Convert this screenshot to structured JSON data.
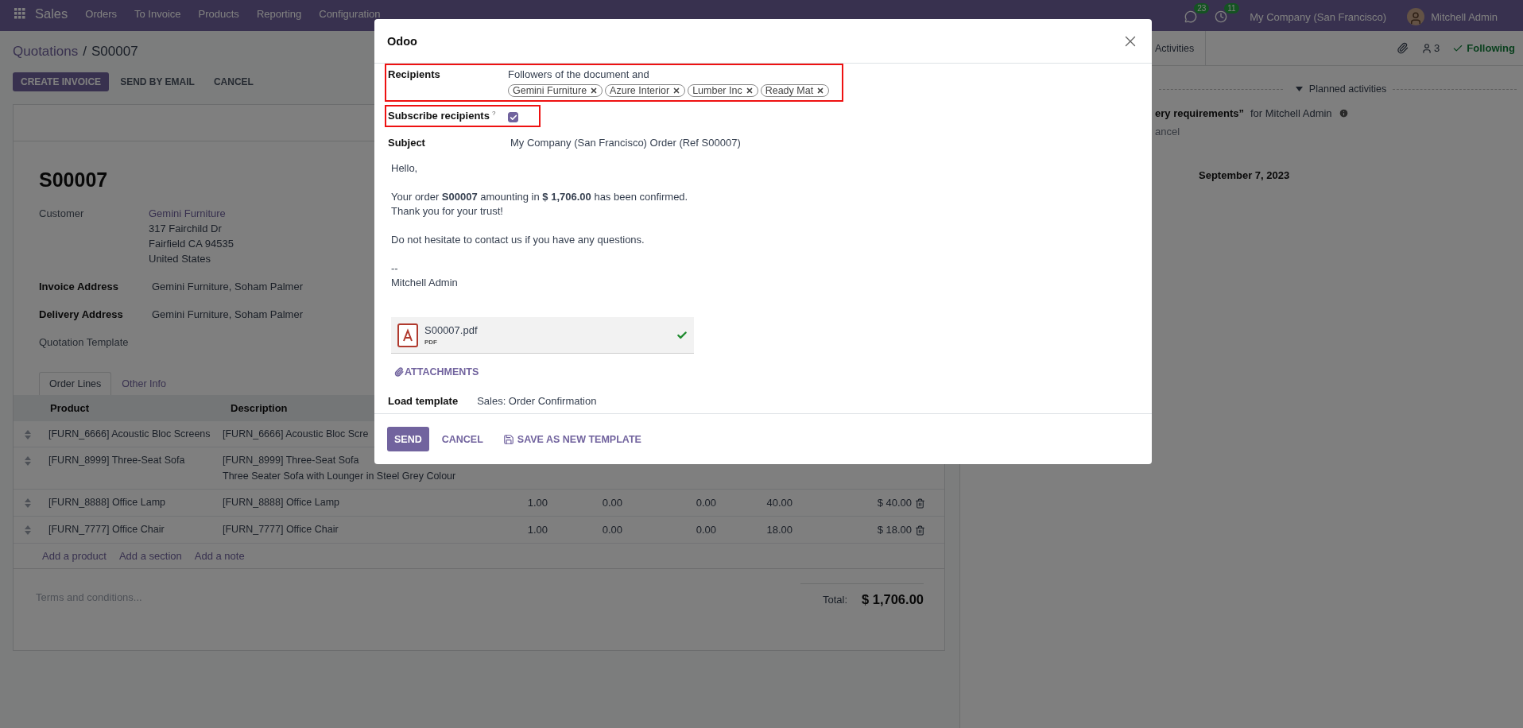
{
  "navbar": {
    "app": "Sales",
    "menu": [
      "Orders",
      "To Invoice",
      "Products",
      "Reporting",
      "Configuration"
    ],
    "messages_count": "23",
    "activities_count": "11",
    "company": "My Company (San Francisco)",
    "user": "Mitchell Admin"
  },
  "control_panel": {
    "breadcrumb": [
      "Quotations",
      "S00007"
    ],
    "separator": "/",
    "buttons": [
      {
        "label": "CREATE INVOICE",
        "primary": true
      },
      {
        "label": "SEND BY EMAIL",
        "primary": false
      },
      {
        "label": "CANCEL",
        "primary": false
      }
    ]
  },
  "form": {
    "name": "S00007",
    "customer": {
      "label": "Customer",
      "value": "Gemini Furniture",
      "address": [
        "317 Fairchild Dr",
        "Fairfield CA 94535",
        "United States"
      ]
    },
    "fields": [
      {
        "label": "Invoice Address",
        "value": "Gemini Furniture, Soham Palmer",
        "required": true
      },
      {
        "label": "Delivery Address",
        "value": "Gemini Furniture, Soham Palmer",
        "required": true
      },
      {
        "label": "Quotation Template",
        "required": false
      }
    ],
    "tabs": [
      {
        "label": "Order Lines",
        "selected": true
      },
      {
        "label": "Other Info",
        "selected": false
      }
    ],
    "table": {
      "columns": [
        "Product",
        "Description"
      ],
      "rows": [
        {
          "product": "[FURN_6666] Acoustic Bloc Screens",
          "description": [
            "[FURN_6666] Acoustic Bloc Scre"
          ]
        },
        {
          "product": "[FURN_8999] Three-Seat Sofa",
          "description": [
            "[FURN_8999] Three-Seat Sofa",
            "Three Seater Sofa with Lounger in Steel Grey Colour"
          ]
        },
        {
          "product": "[FURN_8888] Office Lamp",
          "description": [
            "[FURN_8888] Office Lamp"
          ],
          "values": [
            "1.00",
            "0.00",
            "0.00",
            "40.00",
            "$ 40.00"
          ]
        },
        {
          "product": "[FURN_7777] Office Chair",
          "description": [
            "[FURN_7777] Office Chair"
          ],
          "values": [
            "1.00",
            "0.00",
            "0.00",
            "18.00",
            "$ 18.00"
          ]
        }
      ]
    },
    "add_links": [
      "Add a product",
      "Add a section",
      "Add a note"
    ],
    "terms_placeholder": "Terms and conditions...",
    "total": {
      "label": "Total:",
      "value": "$ 1,706.00"
    }
  },
  "chatter": {
    "activities_button": "Activities",
    "followers_count": "3",
    "following": true,
    "following_label": "Following",
    "planned_title": "Planned activities",
    "activity_title": "ery requirements”",
    "activity_assignee": "for Mitchell Admin",
    "activity_action": "ancel",
    "date": "September 7, 2023"
  },
  "dialog": {
    "title": "Odoo",
    "recipients_label": "Recipients",
    "recipients_text": "Followers of the document and",
    "recipients": [
      "Gemini Furniture",
      "Azure Interior",
      "Lumber Inc",
      "Ready Mat"
    ],
    "subscribe_label": "Subscribe recipients",
    "subscribe_hint": "?",
    "subscribe_checked": true,
    "subject_label": "Subject",
    "subject": "My Company (San Francisco) Order (Ref S00007)",
    "body": [
      [
        "Hello,"
      ],
      [
        "Your order **S00007** amounting in **$ 1,706.00** has been confirmed.",
        "Thank you for your trust!"
      ],
      [
        "Do not hesitate to contact us if you have any questions."
      ],
      [
        "--",
        "Mitchell Admin"
      ]
    ],
    "attachment": {
      "name": "S00007.pdf",
      "type": "PDF",
      "uploaded": true
    },
    "attachments_button": "ATTACHMENTS",
    "template_label": "Load template",
    "template": "Sales: Order Confirmation",
    "buttons": [
      {
        "label": "SEND",
        "kind": "primary"
      },
      {
        "label": "CANCEL",
        "kind": "link"
      },
      {
        "label": "SAVE AS NEW TEMPLATE",
        "kind": "save"
      }
    ]
  }
}
